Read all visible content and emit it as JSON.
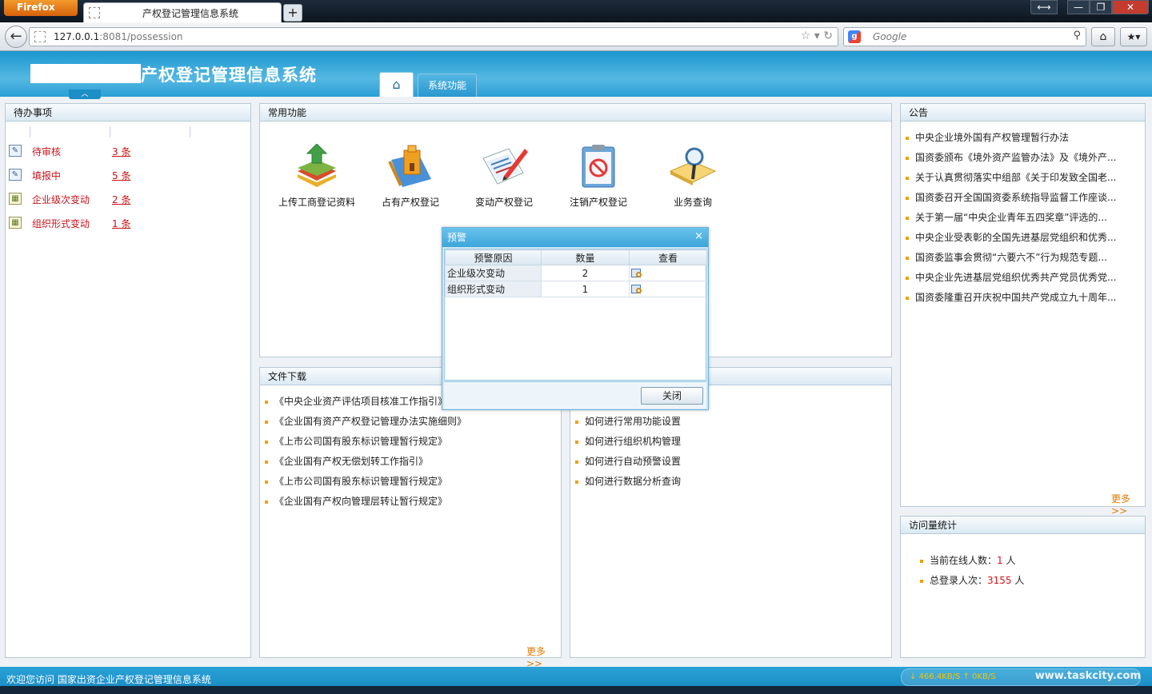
{
  "browser": {
    "menu_label": "Firefox",
    "tab_title": "产权登记管理信息系统",
    "new_tab": "+",
    "url_host": "127.0.0.1",
    "url_rest": ":8081/possession",
    "search_placeholder": "Google",
    "window_buttons": [
      "⟷",
      "—",
      "❐",
      "✕"
    ]
  },
  "app": {
    "title": "产权登记管理信息系统",
    "tabs": [
      {
        "label": "home-icon"
      },
      {
        "label": "系统功能"
      }
    ]
  },
  "todo": {
    "title": "待办事项",
    "items": [
      {
        "label": "待审核",
        "count": "3 条",
        "icon": "edit-icon"
      },
      {
        "label": "填报中",
        "count": "5 条",
        "icon": "edit-icon"
      },
      {
        "label": "企业级次变动",
        "count": "2 条",
        "icon": "calendar-icon"
      },
      {
        "label": "组织形式变动",
        "count": "1 条",
        "icon": "calendar-icon"
      }
    ]
  },
  "common": {
    "title": "常用功能",
    "functions": [
      {
        "label": "上传工商登记资料",
        "icon": "upload-books-icon"
      },
      {
        "label": "占有产权登记",
        "icon": "building-blocks-icon"
      },
      {
        "label": "变动产权登记",
        "icon": "documents-pen-icon"
      },
      {
        "label": "注销产权登记",
        "icon": "cancel-clipboard-icon"
      },
      {
        "label": "业务查询",
        "icon": "search-book-icon"
      }
    ]
  },
  "files": {
    "title": "文件下载",
    "items": [
      "《中央企业资产评估项目核准工作指引》",
      "《企业国有资产产权登记管理办法实施细则》",
      "《上市公司国有股东标识管理暂行规定》",
      "《企业国有产权无偿划转工作指引》",
      "《上市公司国有股东标识管理暂行规定》",
      "《企业国有产权向管理层转让暂行规定》"
    ],
    "more": "更多>>"
  },
  "help": {
    "items": [
      "如何进行常用功能设置",
      "如何进行组织机构管理",
      "如何进行自动预警设置",
      "如何进行数据分析查询"
    ]
  },
  "notice": {
    "title": "公告",
    "items": [
      "中央企业境外国有产权管理暂行办法",
      "国资委颁布《境外资产监管办法》及《境外产...",
      "关于认真贯彻落实中组部《关于印发致全国老...",
      "国资委召开全国国资委系统指导监督工作座谈...",
      "关于第一届“中央企业青年五四奖章”评选的...",
      "中央企业受表彰的全国先进基层党组织和优秀...",
      "国资委监事会贯彻“六要六不”行为规范专题...",
      "中央企业先进基层党组织优秀共产党员优秀党...",
      "国资委隆重召开庆祝中国共产党成立九十周年..."
    ],
    "more": "更多>>"
  },
  "visits": {
    "title": "访问量统计",
    "online_label": "当前在线人数：",
    "online_value": "1",
    "online_unit": " 人",
    "total_label": "总登录人次：",
    "total_value": "3155",
    "total_unit": " 人"
  },
  "dialog": {
    "title": "预警",
    "close_icon": "×",
    "columns": [
      "预警原因",
      "数量",
      "查看"
    ],
    "rows": [
      {
        "reason": "企业级次变动",
        "count": "2"
      },
      {
        "reason": "组织形式变动",
        "count": "1"
      }
    ],
    "close_button": "关闭"
  },
  "statusbar": {
    "text": "欢迎您访问 国家出资企业产权登记管理信息系统",
    "speed": "↓ 466.4KB/S ↑  0KB/S",
    "watermark": "www.taskcity.com"
  },
  "colors": {
    "accent": "#1a96cf",
    "alert": "#c8141b",
    "more": "#e07b00"
  }
}
